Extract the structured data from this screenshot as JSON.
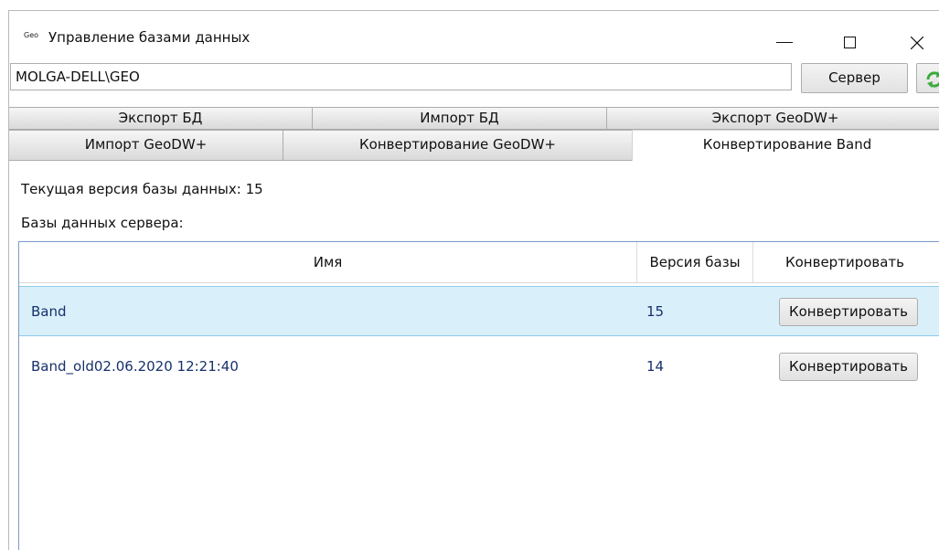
{
  "window": {
    "app_icon_text": "Geo",
    "title": "Управление базами данных"
  },
  "server": {
    "value": "MOLGA-DELL\\GEO",
    "button_label": "Сервер",
    "refresh_icon": "refresh-icon"
  },
  "tabs": {
    "row1": [
      "Экспорт БД",
      "Импорт БД",
      "Экспорт GeoDW+"
    ],
    "row2": [
      "Импорт GeoDW+",
      "Конвертирование GeoDW+",
      "Конвертирование Band"
    ],
    "active": "Конвертирование Band"
  },
  "content": {
    "current_version": "Текущая версия базы данных: 15",
    "server_dbs_label": "Базы данных сервера:"
  },
  "grid": {
    "columns": [
      "Имя",
      "Версия базы",
      "Конвертировать"
    ],
    "rows": [
      {
        "name": "Band",
        "version": "15",
        "action": "Конвертировать",
        "selected": true
      },
      {
        "name": "Band_old02.06.2020 12:21:40",
        "version": "14",
        "action": "Конвертировать",
        "selected": false
      }
    ]
  },
  "colors": {
    "selected_row": "#d9f0fb",
    "row_text": "#17306b",
    "grid_border": "#7a9cc7"
  }
}
